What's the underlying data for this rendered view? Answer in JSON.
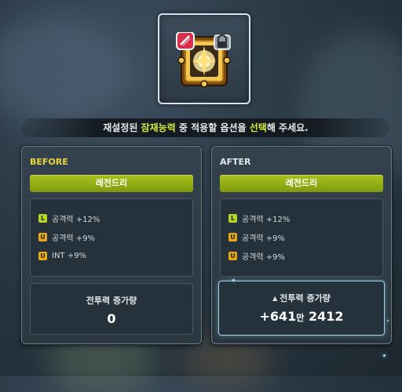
{
  "instruction": {
    "part1": "재설정된 ",
    "highlight1": "잠재능력",
    "part2": " 중 적용할 옵션을 ",
    "highlight2": "선택",
    "part3": "해 주세요."
  },
  "before": {
    "title": "BEFORE",
    "grade": "레전드리",
    "options": [
      {
        "grade_mark": "L",
        "text": "공격력 +12%"
      },
      {
        "grade_mark": "U",
        "text": "공격력 +9%"
      },
      {
        "grade_mark": "U",
        "text": "INT +9%"
      }
    ],
    "cp_label": "전투력 증가량",
    "cp_value": "0"
  },
  "after": {
    "title": "AFTER",
    "grade": "레전드리",
    "options": [
      {
        "grade_mark": "L",
        "text": "공격력 +12%"
      },
      {
        "grade_mark": "U",
        "text": "공격력 +9%"
      },
      {
        "grade_mark": "U",
        "text": "공격력 +9%"
      }
    ],
    "cp_arrow": "▲",
    "cp_label": "전투력 증가량",
    "cp_value_a": "+641",
    "cp_value_unit": "만",
    "cp_value_b": " 2412"
  },
  "colors": {
    "legendary": "#b6d62a",
    "unique": "#e8a818",
    "highlight": "#d4e83a"
  },
  "icons": {
    "item": "emblem-item-icon",
    "lock": "lock-icon",
    "badge": "red-potential-badge-icon"
  }
}
